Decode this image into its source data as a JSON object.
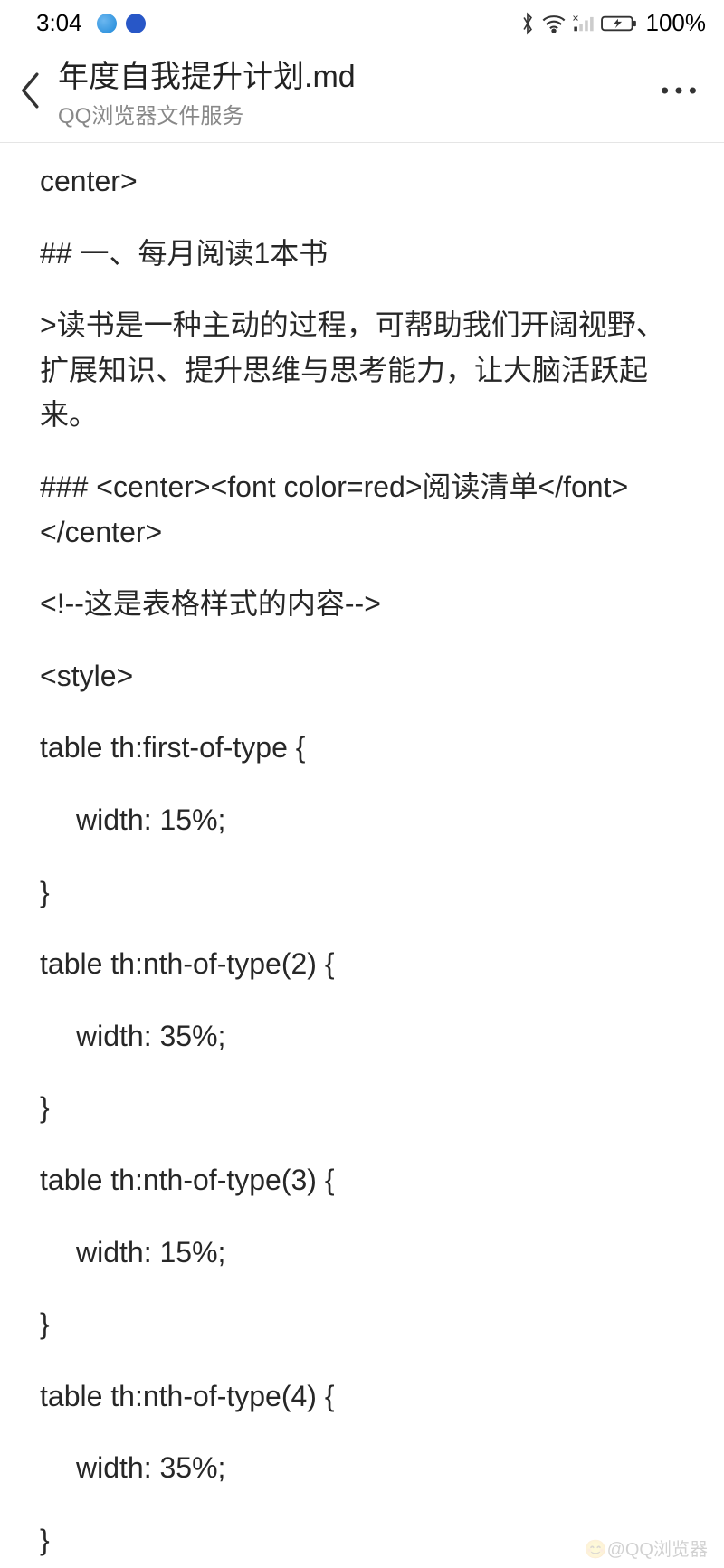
{
  "status": {
    "time": "3:04",
    "battery_percent": "100%"
  },
  "header": {
    "title": "年度自我提升计划.md",
    "subtitle": "QQ浏览器文件服务"
  },
  "content": {
    "lines": [
      "center>",
      "## 一、每月阅读1本书",
      ">读书是一种主动的过程，可帮助我们开阔视野、扩展知识、提升思维与思考能力，让大脑活跃起来。",
      "### <center><font color=red>阅读清单</font></center>",
      "<!--这是表格样式的内容-->",
      "<style>",
      "table th:first-of-type {",
      "width: 15%;",
      "}",
      "table th:nth-of-type(2) {",
      "width: 35%;",
      "}",
      "table th:nth-of-type(3) {",
      "width: 15%;",
      "}",
      "table th:nth-of-type(4) {",
      "width: 35%;",
      "}"
    ]
  },
  "watermark": "😊@QQ浏览器"
}
